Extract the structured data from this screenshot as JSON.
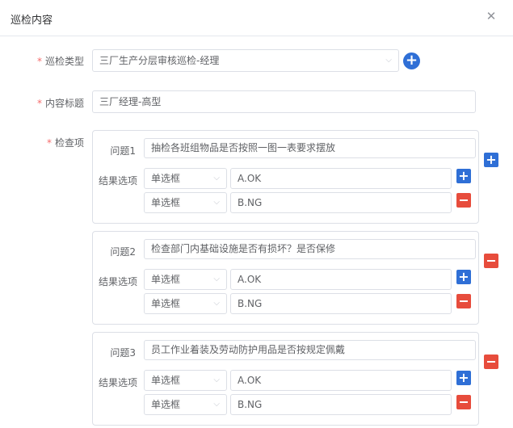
{
  "dialog": {
    "title": "巡检内容"
  },
  "form": {
    "type_label": "巡检类型",
    "type_value": "三厂生产分层审核巡检-经理",
    "title_label": "内容标题",
    "title_value": "三厂经理-高型",
    "items_label": "检查项",
    "result_label": "结果选项"
  },
  "items": [
    {
      "question_label": "问题1",
      "question": "抽检各班组物品是否按照一图一表要求摆放",
      "options": [
        {
          "type": "单选框",
          "value": "A.OK"
        },
        {
          "type": "单选框",
          "value": "B.NG"
        }
      ]
    },
    {
      "question_label": "问题2",
      "question": "检查部门内基础设施是否有损坏？是否保修",
      "options": [
        {
          "type": "单选框",
          "value": "A.OK"
        },
        {
          "type": "单选框",
          "value": "B.NG"
        }
      ]
    },
    {
      "question_label": "问题3",
      "question": "员工作业着装及劳动防护用品是否按规定佩戴",
      "options": [
        {
          "type": "单选框",
          "value": "A.OK"
        },
        {
          "type": "单选框",
          "value": "B.NG"
        }
      ]
    }
  ],
  "icons": {
    "close": "close-icon",
    "add": "plus-icon",
    "remove": "minus-icon",
    "dropdown": "chevron-down-icon"
  },
  "colors": {
    "primary": "#2f6fd6",
    "danger": "#e74c3c",
    "required": "#f56c6c"
  }
}
